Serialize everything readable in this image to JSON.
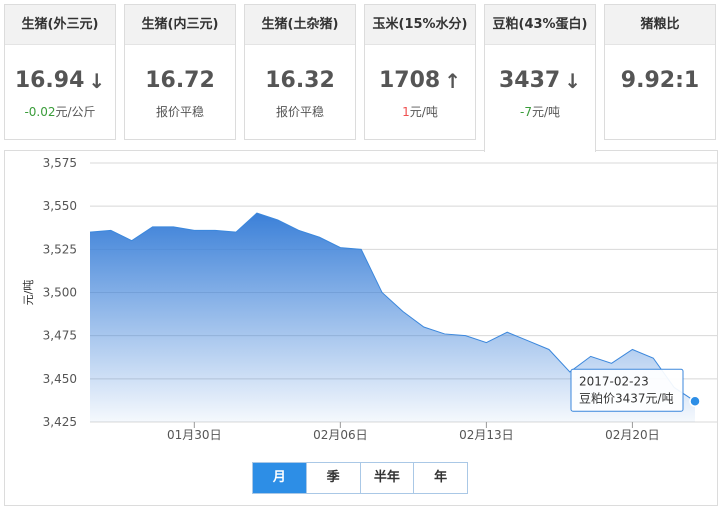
{
  "cards": [
    {
      "id": "hog-outer",
      "title": "生猪(外三元)",
      "value": "16.94",
      "arrow": "down",
      "sub_prefix": "-0.02",
      "sub_suffix": "元/公斤",
      "trend": "down"
    },
    {
      "id": "hog-inner",
      "title": "生猪(内三元)",
      "value": "16.72",
      "arrow": "",
      "sub_prefix": "",
      "sub_suffix": "报价平稳",
      "trend": "flat"
    },
    {
      "id": "hog-native",
      "title": "生猪(土杂猪)",
      "value": "16.32",
      "arrow": "",
      "sub_prefix": "",
      "sub_suffix": "报价平稳",
      "trend": "flat"
    },
    {
      "id": "corn",
      "title": "玉米(15%水分)",
      "value": "1708",
      "arrow": "up",
      "sub_prefix": "1",
      "sub_suffix": "元/吨",
      "trend": "up"
    },
    {
      "id": "soymeal",
      "title": "豆粕(43%蛋白)",
      "value": "3437",
      "arrow": "down",
      "sub_prefix": "-7",
      "sub_suffix": "元/吨",
      "trend": "down"
    },
    {
      "id": "hog-grain-ratio",
      "title": "猪粮比",
      "value": "9.92:1",
      "arrow": "",
      "sub_prefix": "",
      "sub_suffix": "",
      "trend": "flat"
    }
  ],
  "active_card": 4,
  "colors": {
    "up": "#f05050",
    "down": "#3a9c3a",
    "line": "#3b87dc",
    "accent": "#2d8ee6"
  },
  "chart_data": {
    "type": "area",
    "ylabel": "元/吨",
    "ylim": [
      3425,
      3575
    ],
    "yticks": [
      "3,425",
      "3,450",
      "3,475",
      "3,500",
      "3,525",
      "3,550",
      "3,575"
    ],
    "ytick_values": [
      3425,
      3450,
      3475,
      3500,
      3525,
      3550,
      3575
    ],
    "xtick_labels": [
      "01月30日",
      "02月06日",
      "02月13日",
      "02月20日"
    ],
    "xtick_dates": [
      "2017-01-30",
      "2017-02-06",
      "2017-02-13",
      "2017-02-20"
    ],
    "x": [
      "2017-01-25",
      "2017-01-26",
      "2017-01-27",
      "2017-01-28",
      "2017-01-29",
      "2017-01-30",
      "2017-01-31",
      "2017-02-01",
      "2017-02-02",
      "2017-02-03",
      "2017-02-04",
      "2017-02-05",
      "2017-02-06",
      "2017-02-07",
      "2017-02-08",
      "2017-02-09",
      "2017-02-10",
      "2017-02-11",
      "2017-02-12",
      "2017-02-13",
      "2017-02-14",
      "2017-02-15",
      "2017-02-16",
      "2017-02-17",
      "2017-02-18",
      "2017-02-19",
      "2017-02-20",
      "2017-02-21",
      "2017-02-22",
      "2017-02-23"
    ],
    "x_start": "2017-01-25",
    "x_end": "2017-02-23",
    "series": [
      {
        "values": [
          3535,
          3536,
          3530,
          3538,
          3538,
          3536,
          3536,
          3535,
          3546,
          3542,
          3536,
          3532,
          3526,
          3525,
          3500,
          3489,
          3480,
          3476,
          3475,
          3471,
          3477,
          3472,
          3467,
          3454,
          3463,
          3459,
          3467,
          3462,
          3445,
          3437
        ]
      }
    ],
    "grid": true,
    "tooltip": {
      "date": "2017-02-23",
      "label": "豆粕价3437元/吨"
    }
  },
  "range_buttons": [
    {
      "label": "月",
      "selected": true
    },
    {
      "label": "季",
      "selected": false
    },
    {
      "label": "半年",
      "selected": false
    },
    {
      "label": "年",
      "selected": false
    }
  ]
}
